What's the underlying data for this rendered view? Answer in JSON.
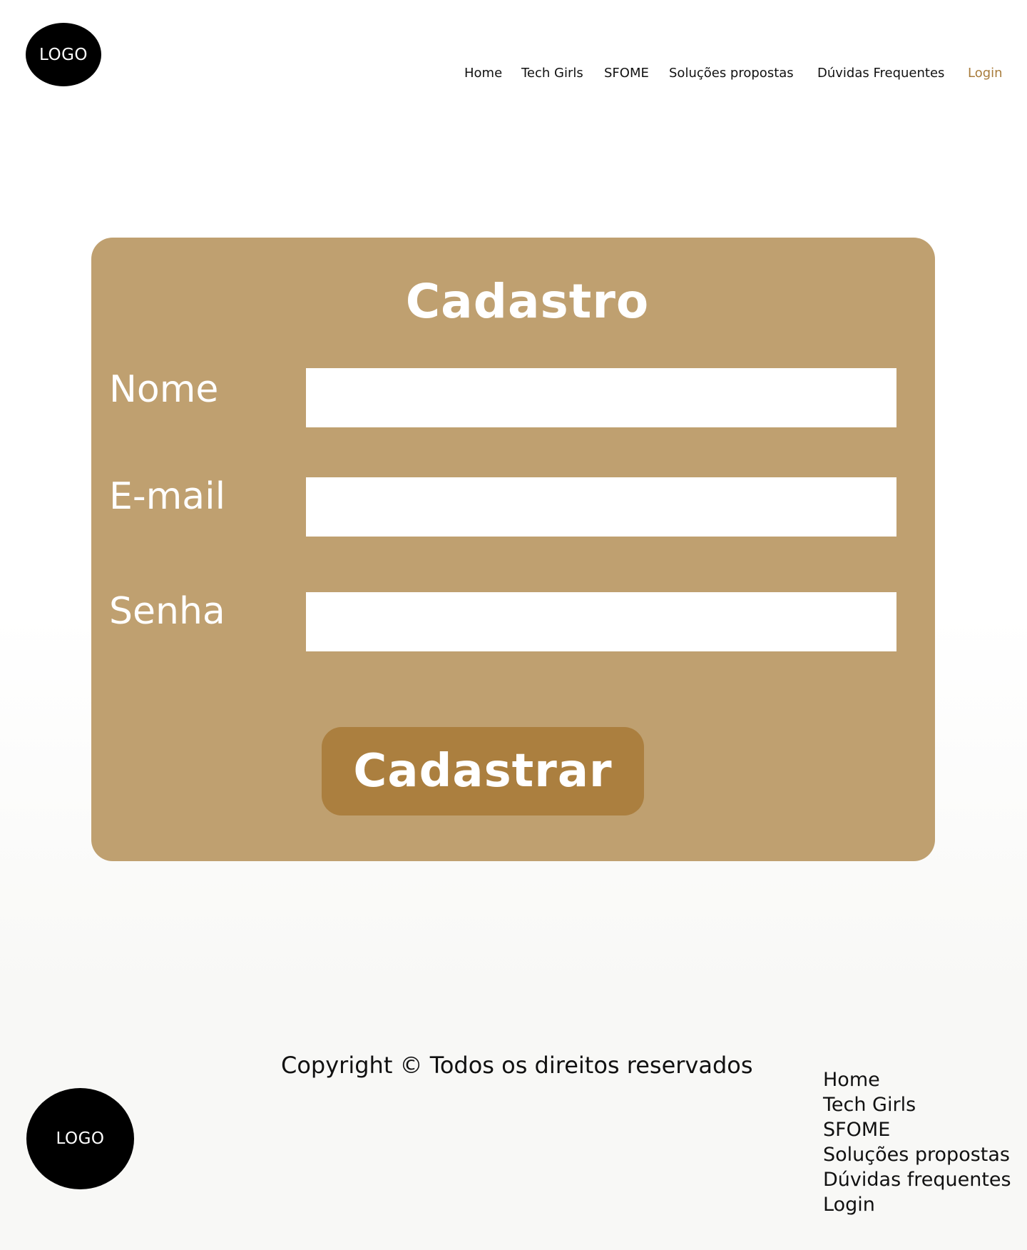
{
  "header": {
    "logo_text": "LOGO",
    "nav": [
      {
        "label": "Home"
      },
      {
        "label": "Tech Girls"
      },
      {
        "label": "SFOME"
      },
      {
        "label": "Soluções propostas"
      },
      {
        "label": "Dúvidas Frequentes"
      },
      {
        "label": "Login"
      }
    ]
  },
  "form": {
    "title": "Cadastro",
    "fields": [
      {
        "label": "Nome",
        "value": "",
        "placeholder": ""
      },
      {
        "label": "E-mail",
        "value": "",
        "placeholder": ""
      },
      {
        "label": "Senha",
        "value": "",
        "placeholder": ""
      }
    ],
    "submit_label": "Cadastrar"
  },
  "footer": {
    "copyright": "Copyright © Todos os direitos reservados",
    "logo_text": "LOGO",
    "nav": [
      {
        "label": "Home"
      },
      {
        "label": "Tech Girls"
      },
      {
        "label": "SFOME"
      },
      {
        "label": "Soluções propostas"
      },
      {
        "label": "Dúvidas frequentes"
      },
      {
        "label": "Login"
      }
    ]
  },
  "colors": {
    "card_background": "#bfa070",
    "button_background": "#ab7f3f",
    "login_link": "#a87c3c",
    "logo_background": "#000000"
  }
}
